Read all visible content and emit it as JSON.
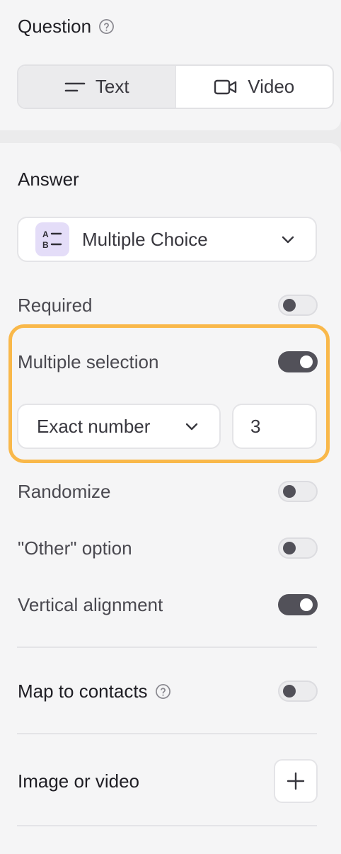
{
  "question": {
    "title": "Question",
    "tabs": [
      {
        "label": "Text",
        "icon": "text-lines-icon",
        "active": true
      },
      {
        "label": "Video",
        "icon": "video-camera-icon",
        "active": false
      }
    ]
  },
  "answer": {
    "title": "Answer",
    "type_select": {
      "value": "Multiple Choice",
      "icon": "multiple-choice-icon"
    },
    "options": {
      "required": {
        "label": "Required",
        "on": false
      },
      "multiple_selection": {
        "label": "Multiple selection",
        "on": true
      },
      "randomize": {
        "label": "Randomize",
        "on": false
      },
      "other_option": {
        "label": "\"Other\" option",
        "on": false
      },
      "vertical_alignment": {
        "label": "Vertical alignment",
        "on": true
      }
    },
    "selection_rule": {
      "value": "Exact number",
      "count": "3"
    }
  },
  "map_to_contacts": {
    "label": "Map to contacts",
    "on": false
  },
  "image_or_video": {
    "label": "Image or video",
    "add_icon": "plus-icon"
  },
  "colors": {
    "highlight": "#f9b84a",
    "toggle_on": "#525159",
    "choice_icon_bg": "#e4ddf8"
  }
}
